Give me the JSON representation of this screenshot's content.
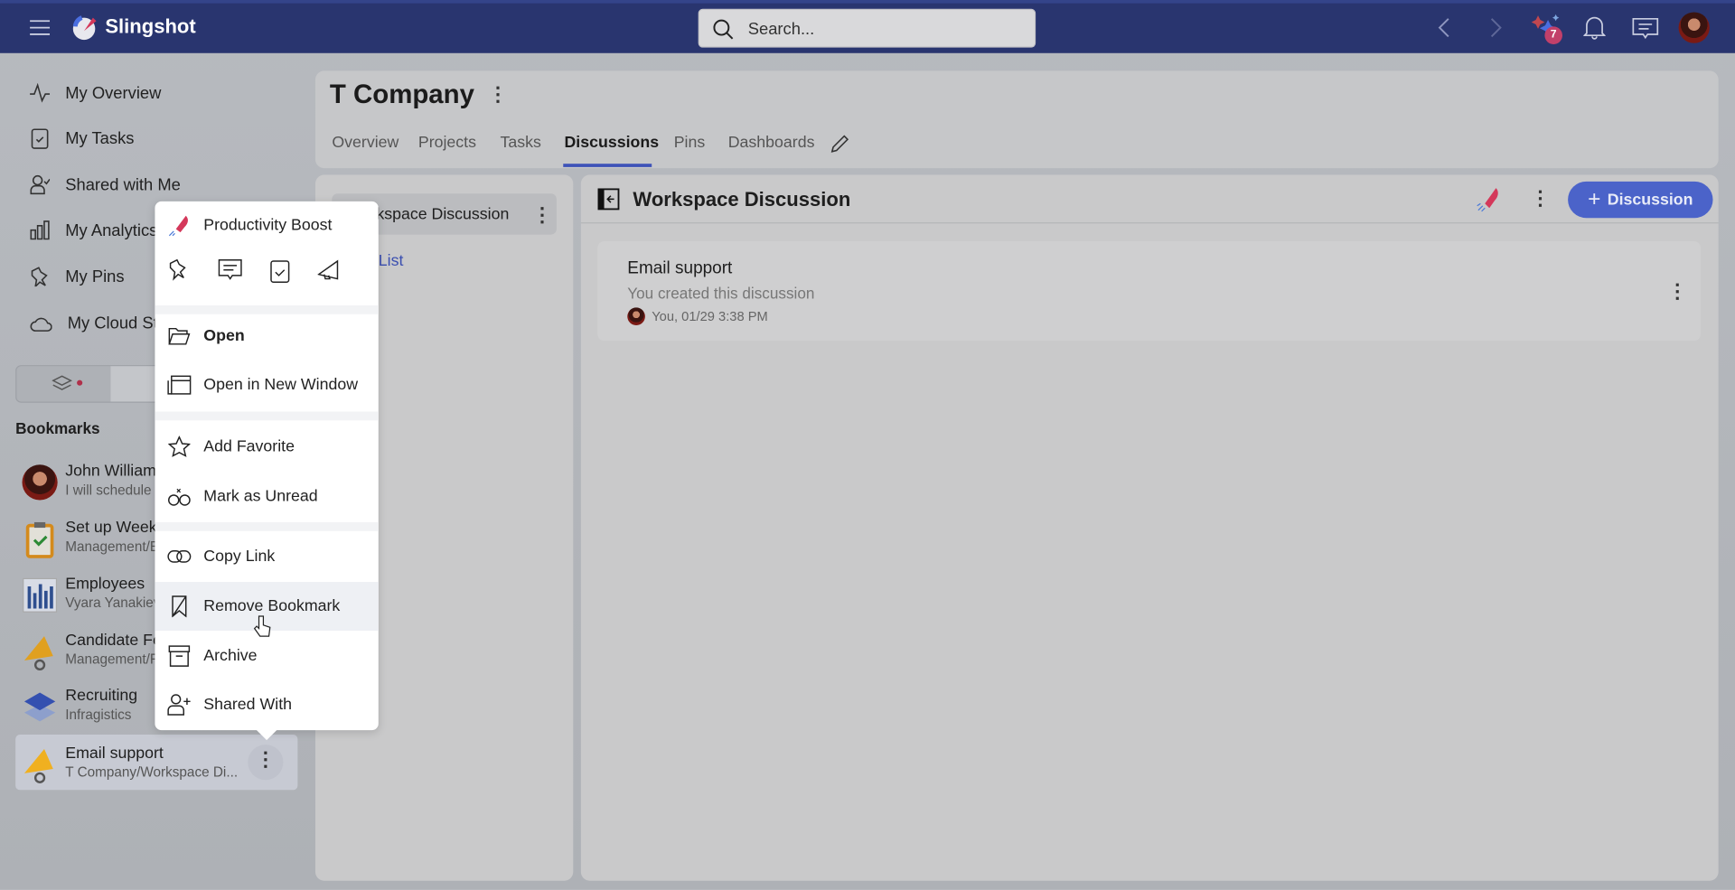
{
  "app": {
    "name": "Slingshot",
    "search_placeholder": "Search...",
    "notifications_badge": "7"
  },
  "sidebar": {
    "items": [
      {
        "label": "My Overview",
        "icon": "pulse-icon"
      },
      {
        "label": "My Tasks",
        "icon": "clipboard-check-icon"
      },
      {
        "label": "Shared with Me",
        "icon": "user-check-icon"
      },
      {
        "label": "My Analytics",
        "icon": "bar-chart-icon"
      },
      {
        "label": "My Pins",
        "icon": "pin-icon"
      },
      {
        "label": "My Cloud Sto",
        "icon": "cloud-icon"
      }
    ],
    "bookmarks_title": "Bookmarks",
    "bookmarks": [
      {
        "title": "John William",
        "subtitle": "I will schedule"
      },
      {
        "title": "Set up Weekl",
        "subtitle": "Management/E"
      },
      {
        "title": "Employees",
        "subtitle": "Vyara Yanakiev"
      },
      {
        "title": "Candidate Fe",
        "subtitle": "Management/F"
      },
      {
        "title": "Recruiting",
        "subtitle": "Infragistics"
      },
      {
        "title": "Email support",
        "subtitle": "T Company/Workspace Di..."
      }
    ]
  },
  "workspace": {
    "title": "T Company",
    "tabs": [
      "Overview",
      "Projects",
      "Tasks",
      "Discussions",
      "Pins",
      "Dashboards"
    ],
    "active_tab": "Discussions"
  },
  "discussions_list": {
    "item": "kspace Discussion",
    "link": "List"
  },
  "discussion": {
    "title": "Workspace Discussion",
    "new_button": "Discussion",
    "card": {
      "title": "Email support",
      "subtitle": "You created this discussion",
      "meta": "You, 01/29 3:38 PM"
    }
  },
  "context_menu": {
    "boost": "Productivity Boost",
    "items": [
      "Open",
      "Open in New Window",
      "Add Favorite",
      "Mark as Unread",
      "Copy Link",
      "Remove Bookmark",
      "Archive",
      "Shared With"
    ],
    "hovered": "Remove Bookmark"
  },
  "colors": {
    "topbar": "#29356f",
    "accent": "#4b63c9",
    "rocket": "#d4385a"
  }
}
